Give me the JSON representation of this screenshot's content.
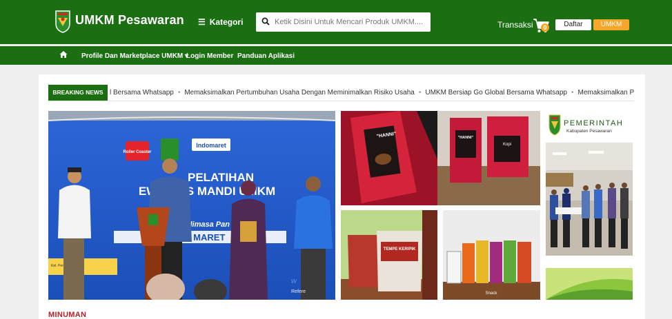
{
  "header": {
    "brand": "UMKM Pesawaran",
    "kategori_label": "Kategori",
    "search_placeholder": "Ketik Disini Untuk Mencari Produk UMKM....",
    "transaksi_label": "Transaksi",
    "cart_count": "0",
    "daftar_label": "Daftar",
    "umkm_label": "UMKM",
    "logo_text": "PESAWARAN"
  },
  "nav": {
    "items": [
      {
        "label": "Profile Dan Marketplace UMKM ▾"
      },
      {
        "label": "Login Member"
      },
      {
        "label": "Panduan Aplikasi"
      }
    ]
  },
  "breaking": {
    "label": "BREAKING NEWS",
    "items": [
      "l Bersama Whatsapp",
      "Memaksimalkan Pertumbuhan Usaha Dengan Meminimalkan Risiko Usaha",
      "UMKM Bersiap Go Global Bersama Whatsapp",
      "Memaksimalkan Pertumbul"
    ]
  },
  "hero": {
    "line1": "PELATIHAN",
    "line2": "EWIRAUS  MANDI  UMKM",
    "line3": "\"Strategi Um         dimasa Pan        ID-19\"",
    "line4": "PESA         17 MARET",
    "badge_roller": "Roller Coaster",
    "badge_indomaret": "Indomaret",
    "watermark": "Refere",
    "podium_sign": "Kel. Pem",
    "w_text": "w"
  },
  "tiles": {
    "coffee_brand": "\"HANNI\"",
    "coffee_note": "Kopi",
    "keripik_label": "TEMPE KERIPIK",
    "snacks_label": "Snack"
  },
  "side_banner": {
    "title": "PEMERINTAH",
    "subtitle": "Kabupaten Pesawaran"
  },
  "section": {
    "title": "MINUMAN"
  },
  "colors": {
    "green": "#1c6e12",
    "orange": "#f6a62b",
    "section_red": "#b4202a"
  }
}
